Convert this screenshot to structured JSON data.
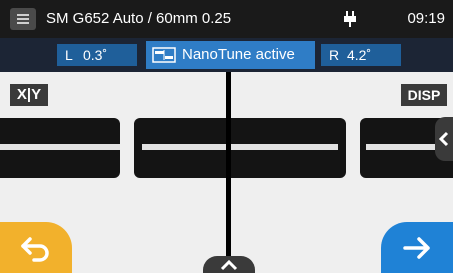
{
  "header": {
    "title": "SM G652 Auto / 60mm 0.25",
    "time": "09:19"
  },
  "status": {
    "left_label": "L",
    "left_value": "0.3˚",
    "nanotune_label": "NanoTune active",
    "right_label": "R",
    "right_value": "4.2˚"
  },
  "view": {
    "xy_label": "X|Y",
    "disp_label": "DISP"
  },
  "icons": {
    "menu": "menu-icon",
    "power": "usb-power-icon",
    "nanotune": "nanotune-icon",
    "side_tab": "chevron-left-icon",
    "back": "back-arrow-icon",
    "next": "right-arrow-icon",
    "up_tab": "chevron-up-icon"
  },
  "colors": {
    "topbar": "#1a1a1a",
    "pill": "#1f5f9a",
    "nanotune_active": "#2f7dc6",
    "back_button": "#f2b12c",
    "next_button": "#1f82d6",
    "view_bg": "#efefef"
  }
}
